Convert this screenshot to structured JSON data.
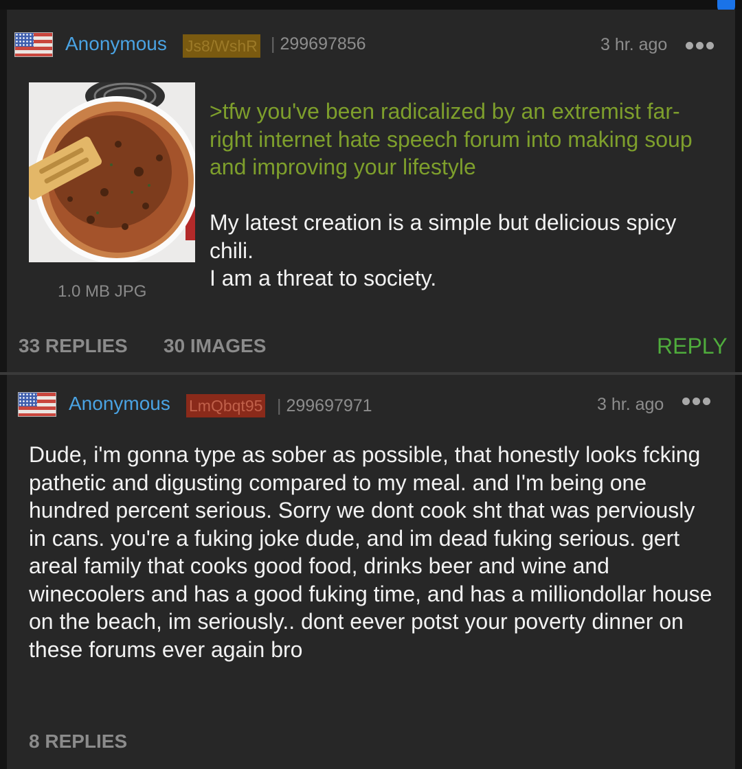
{
  "post1": {
    "author": "Anonymous",
    "poster_id": "Js8/WshR",
    "post_number": "299697856",
    "time": "3 hr. ago",
    "file_info": "1.0 MB JPG",
    "greentext": ">tfw you've been radicalized by an extremist far-right internet hate speech forum into making soup and improving your lifestyle",
    "body": "My latest creation is a simple but delicious spicy chili.\nI am a threat to society.",
    "replies": "33 REPLIES",
    "images": "30 IMAGES",
    "reply_label": "REPLY"
  },
  "post2": {
    "author": "Anonymous",
    "poster_id": "LmQbqt95",
    "post_number": "299697971",
    "time": "3 hr. ago",
    "body": "Dude, i'm gonna type as sober as possible, that honestly looks fcking pathetic and digusting compared to my meal. and I'm being one hundred percent serious. Sorry we dont cook sht that was perviously in cans. you're a fuking joke dude, and im dead fuking serious. gert areal family that cooks good food, drinks beer and wine and winecoolers and has a good fuking time, and has a milliondollar house on the beach, im seriously.. dont eever potst your poverty dinner on these forums ever again bro",
    "replies": "8 REPLIES"
  },
  "icons": {
    "flag": "us-flag-icon",
    "menu": "more-options-icon"
  },
  "colors": {
    "background": "#272727",
    "name": "#4aa3e3",
    "greentext": "#7e9f2c",
    "reply": "#4fac3c",
    "scrollbar": "#1a73e8"
  }
}
